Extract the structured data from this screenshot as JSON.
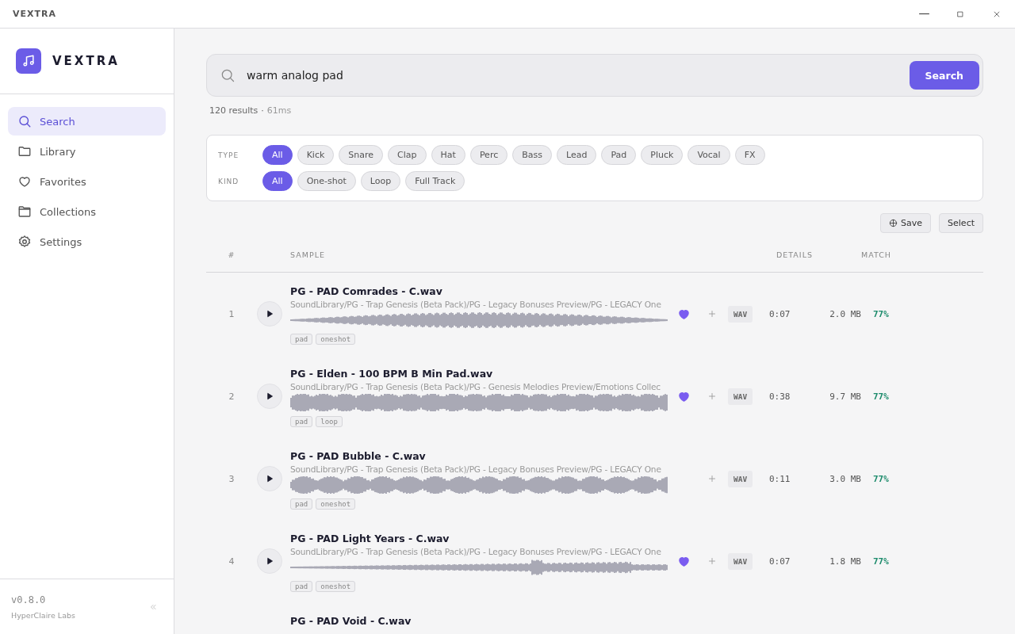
{
  "window": {
    "title": "VEXTRA"
  },
  "sidebar": {
    "brand": "VEXTRA",
    "items": [
      {
        "label": "Search",
        "selected": true
      },
      {
        "label": "Library",
        "selected": false
      },
      {
        "label": "Favorites",
        "selected": false
      },
      {
        "label": "Collections",
        "selected": false
      },
      {
        "label": "Settings",
        "selected": false
      }
    ],
    "version": "v0.8.0",
    "company": "HyperClaire Labs"
  },
  "search": {
    "value": "warm analog pad",
    "button": "Search",
    "summary": "120 results",
    "separator": "·",
    "timing": "61ms"
  },
  "filters": [
    {
      "label": "TYPE",
      "options": [
        {
          "label": "All",
          "selected": true
        },
        {
          "label": "Kick",
          "selected": false
        },
        {
          "label": "Snare",
          "selected": false
        },
        {
          "label": "Clap",
          "selected": false
        },
        {
          "label": "Hat",
          "selected": false
        },
        {
          "label": "Perc",
          "selected": false
        },
        {
          "label": "Bass",
          "selected": false
        },
        {
          "label": "Lead",
          "selected": false
        },
        {
          "label": "Pad",
          "selected": false
        },
        {
          "label": "Pluck",
          "selected": false
        },
        {
          "label": "Vocal",
          "selected": false
        },
        {
          "label": "FX",
          "selected": false
        }
      ]
    },
    {
      "label": "KIND",
      "options": [
        {
          "label": "All",
          "selected": true
        },
        {
          "label": "One-shot",
          "selected": false
        },
        {
          "label": "Loop",
          "selected": false
        },
        {
          "label": "Full Track",
          "selected": false
        }
      ]
    }
  ],
  "actions": [
    "Save",
    "Select"
  ],
  "table": {
    "columns": [
      "#",
      "SAMPLE",
      "DETAILS",
      "MATCH"
    ],
    "rows": [
      {
        "number": "1",
        "title": "PG - PAD Comrades - C.wav",
        "path": "SoundLibrary/PG - Trap Genesis (Beta Pack)/PG - Legacy Bonuses Preview/PG - LEGACY One",
        "tags": [
          "pad",
          "oneshot"
        ],
        "favorite": true,
        "format": "WAV",
        "duration": "0:07",
        "size": "2.0 MB",
        "match": "77%"
      },
      {
        "number": "2",
        "title": "PG - Elden - 100 BPM B Min Pad.wav",
        "path": "SoundLibrary/PG - Trap Genesis (Beta Pack)/PG - Genesis Melodies Preview/Emotions Collec",
        "tags": [
          "pad",
          "loop"
        ],
        "favorite": true,
        "format": "WAV",
        "duration": "0:38",
        "size": "9.7 MB",
        "match": "77%"
      },
      {
        "number": "3",
        "title": "PG - PAD Bubble - C.wav",
        "path": "SoundLibrary/PG - Trap Genesis (Beta Pack)/PG - Legacy Bonuses Preview/PG - LEGACY One",
        "tags": [
          "pad",
          "oneshot"
        ],
        "favorite": false,
        "format": "WAV",
        "duration": "0:11",
        "size": "3.0 MB",
        "match": "77%"
      },
      {
        "number": "4",
        "title": "PG - PAD Light Years - C.wav",
        "path": "SoundLibrary/PG - Trap Genesis (Beta Pack)/PG - Legacy Bonuses Preview/PG - LEGACY One",
        "tags": [
          "pad",
          "oneshot"
        ],
        "favorite": true,
        "format": "WAV",
        "duration": "0:07",
        "size": "1.8 MB",
        "match": "77%"
      },
      {
        "title": "PG - PAD Void - C.wav"
      }
    ]
  }
}
